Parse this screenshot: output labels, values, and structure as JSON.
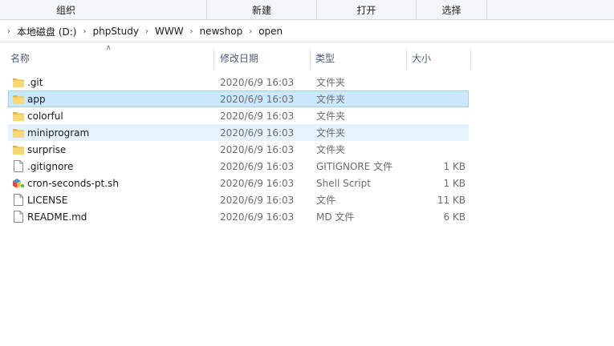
{
  "ribbon": {
    "groups": [
      "组织",
      "新建",
      "打开",
      "选择"
    ]
  },
  "address": {
    "segments": [
      "本地磁盘 (D:)",
      "phpStudy",
      "WWW",
      "newshop",
      "open"
    ]
  },
  "columns": {
    "name": "名称",
    "date": "修改日期",
    "type": "类型",
    "size": "大小"
  },
  "colors": {
    "folder": "#f8d775",
    "folder_dark": "#e8b93e",
    "selected_bg": "#cce8ff",
    "hover_bg": "#e5f3ff"
  },
  "files": [
    {
      "name": ".git",
      "date": "2020/6/9 16:03",
      "type": "文件夹",
      "size": "",
      "icon": "folder-icon",
      "state": "normal"
    },
    {
      "name": "app",
      "date": "2020/6/9 16:03",
      "type": "文件夹",
      "size": "",
      "icon": "folder-icon",
      "state": "selected"
    },
    {
      "name": "colorful",
      "date": "2020/6/9 16:03",
      "type": "文件夹",
      "size": "",
      "icon": "folder-icon",
      "state": "normal"
    },
    {
      "name": "miniprogram",
      "date": "2020/6/9 16:03",
      "type": "文件夹",
      "size": "",
      "icon": "folder-icon",
      "state": "hover"
    },
    {
      "name": "surprise",
      "date": "2020/6/9 16:03",
      "type": "文件夹",
      "size": "",
      "icon": "folder-icon",
      "state": "normal"
    },
    {
      "name": ".gitignore",
      "date": "2020/6/9 16:03",
      "type": "GITIGNORE 文件",
      "size": "1 KB",
      "icon": "file-icon",
      "state": "normal"
    },
    {
      "name": "cron-seconds-pt.sh",
      "date": "2020/6/9 16:03",
      "type": "Shell Script",
      "size": "1 KB",
      "icon": "shell-script-icon",
      "state": "normal"
    },
    {
      "name": "LICENSE",
      "date": "2020/6/9 16:03",
      "type": "文件",
      "size": "11 KB",
      "icon": "file-icon",
      "state": "normal"
    },
    {
      "name": "README.md",
      "date": "2020/6/9 16:03",
      "type": "MD 文件",
      "size": "6 KB",
      "icon": "file-icon",
      "state": "normal"
    }
  ]
}
